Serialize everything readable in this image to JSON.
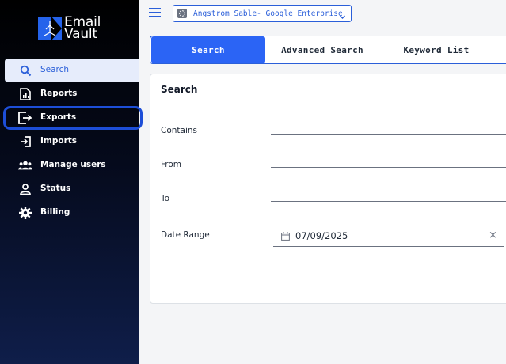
{
  "logo": {
    "line1": "Email",
    "line2": "Vault"
  },
  "sidebar": {
    "items": [
      {
        "label": "Search",
        "icon": "search-icon"
      },
      {
        "label": "Reports",
        "icon": "report-icon"
      },
      {
        "label": "Exports",
        "icon": "export-icon"
      },
      {
        "label": "Imports",
        "icon": "import-icon"
      },
      {
        "label": "Manage users",
        "icon": "users-icon"
      },
      {
        "label": "Status",
        "icon": "person-icon"
      },
      {
        "label": "Billing",
        "icon": "gear-icon"
      }
    ]
  },
  "topbar": {
    "account": "Angstrom Sable- Google Enterprise"
  },
  "tabs": [
    {
      "label": "Search"
    },
    {
      "label": "Advanced Search"
    },
    {
      "label": "Keyword List"
    }
  ],
  "search_form": {
    "title": "Search",
    "contains_label": "Contains",
    "from_label": "From",
    "to_label": "To",
    "date_range_label": "Date Range",
    "date_value": "07/09/2025",
    "clear_symbol": "×"
  },
  "colors": {
    "accent": "#2b64f5",
    "sidebar_bg": "#000000",
    "active_nav_bg": "#e6ecfb",
    "focus_ring": "#1d4ed8"
  }
}
